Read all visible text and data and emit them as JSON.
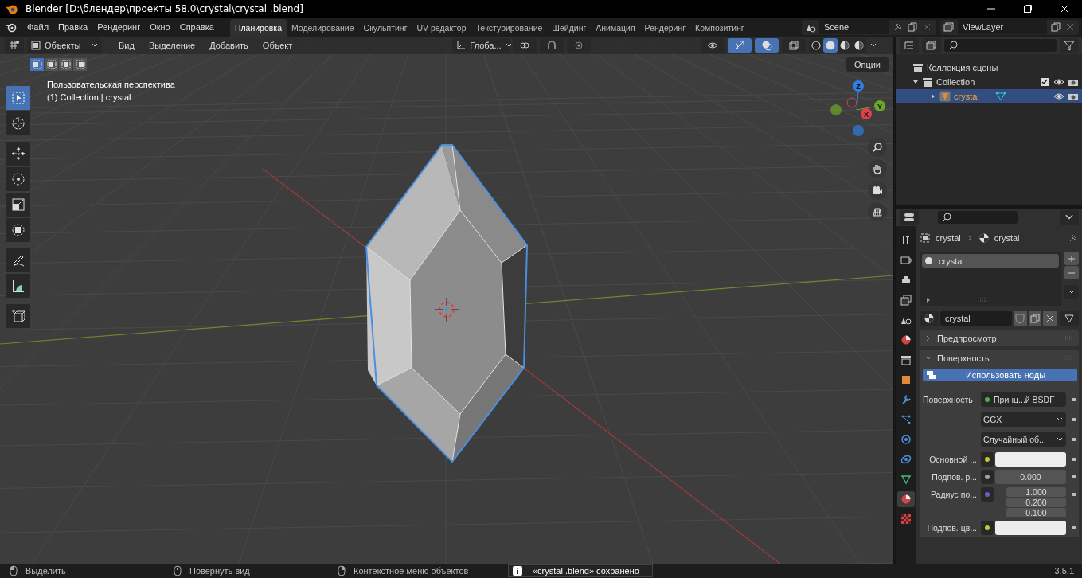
{
  "window": {
    "title": "Blender [D:\\блендер\\проекты 58.0\\crystal\\crystal .blend]"
  },
  "menu": [
    "Файл",
    "Правка",
    "Рендеринг",
    "Окно",
    "Справка"
  ],
  "workspaces": [
    {
      "label": "Планировка",
      "selected": true
    },
    {
      "label": "Моделирование",
      "selected": false
    },
    {
      "label": "Скульптинг",
      "selected": false
    },
    {
      "label": "UV-редактор",
      "selected": false
    },
    {
      "label": "Текстурирование",
      "selected": false
    },
    {
      "label": "Шейдинг",
      "selected": false
    },
    {
      "label": "Анимация",
      "selected": false
    },
    {
      "label": "Рендеринг",
      "selected": false
    },
    {
      "label": "Композитинг",
      "selected": false
    }
  ],
  "scene": "Scene",
  "view_layer": "ViewLayer",
  "viewport": {
    "mode": "Объекты",
    "menus": [
      "Вид",
      "Выделение",
      "Добавить",
      "Объект"
    ],
    "orientation": "Глоба...",
    "options": "Опции",
    "select_modes": [
      {
        "selected": true
      },
      {
        "selected": false
      },
      {
        "selected": false
      },
      {
        "selected": false
      }
    ],
    "toggles": [
      {
        "kind": "gizmo",
        "on": true
      },
      {
        "kind": "overlay",
        "on": true
      },
      {
        "kind": "xray",
        "on": false
      }
    ],
    "shading": [
      {
        "selected": false
      },
      {
        "selected": true
      },
      {
        "selected": false
      },
      {
        "selected": false
      }
    ],
    "view_name": "Пользовательская перспектива",
    "object_info": "(1) Collection | crystal",
    "tools": [
      {
        "kind": "select",
        "selected": true
      },
      {
        "kind": "cursor",
        "selected": false
      },
      {
        "kind": "move",
        "selected": false
      },
      {
        "kind": "rotate",
        "selected": false
      },
      {
        "kind": "scale",
        "selected": false
      },
      {
        "kind": "transform",
        "selected": false
      },
      {
        "kind": "annotate",
        "selected": false
      },
      {
        "kind": "measure",
        "selected": false
      },
      {
        "kind": "add",
        "selected": false
      }
    ],
    "axes": [
      {
        "label": "Z",
        "color": "#2f7ee0"
      },
      {
        "label": "Y",
        "color": "#6fa52b"
      },
      {
        "label": "X",
        "color": "#e0404a"
      }
    ]
  },
  "outliner": {
    "label": "Коллекция сцены",
    "children": [
      {
        "label": "Collection",
        "expanded": true,
        "checked": true,
        "selected": false,
        "children": [
          {
            "label": "crystal",
            "expanded": false,
            "selected": true
          }
        ]
      }
    ]
  },
  "properties": {
    "tabs": [
      {
        "kind": "tool",
        "selected": false
      },
      {
        "kind": "render",
        "selected": false
      },
      {
        "kind": "output",
        "selected": false
      },
      {
        "kind": "viewlayer",
        "selected": false
      },
      {
        "kind": "scene",
        "selected": false
      },
      {
        "kind": "world",
        "selected": false
      },
      {
        "kind": "collection",
        "selected": false
      },
      {
        "kind": "object",
        "selected": false
      },
      {
        "kind": "modifiers",
        "selected": false
      },
      {
        "kind": "particles",
        "selected": false
      },
      {
        "kind": "physics",
        "selected": false
      },
      {
        "kind": "constraints",
        "selected": false
      },
      {
        "kind": "data",
        "selected": false
      },
      {
        "kind": "material",
        "selected": true
      },
      {
        "kind": "texture",
        "selected": false
      }
    ],
    "breadcrumb": [
      "crystal",
      "crystal"
    ],
    "slots": [
      {
        "label": "crystal",
        "selected": true
      }
    ],
    "material": "crystal",
    "panels": [
      {
        "label": "Предпросмотр",
        "expanded": false
      },
      {
        "label": "Поверхность",
        "expanded": true
      }
    ],
    "use_nodes": "Использовать ноды",
    "fields": [
      {
        "kind": "link",
        "label": "Поверхность",
        "value": "Принц...й BSDF",
        "color": "#4cb04c"
      },
      {
        "kind": "dropdown",
        "value": "GGX"
      },
      {
        "kind": "dropdown",
        "value": "Случайный об..."
      },
      {
        "kind": "swatch",
        "label": "Основной ...",
        "color": "#c7c729"
      },
      {
        "kind": "number",
        "label": "Подпов. р...",
        "value": "0.000",
        "color": "#a1a1a1"
      },
      {
        "kind": "vector",
        "label": "Радиус по...",
        "values": [
          "1.000",
          "0.200",
          "0.100"
        ],
        "color": "#6363c7"
      },
      {
        "kind": "swatch",
        "label": "Подпов. цв...",
        "color": "#c7c729"
      }
    ]
  },
  "status": {
    "hints": [
      {
        "kind": "left",
        "label": "Выделить"
      },
      {
        "kind": "middle",
        "label": "Повернуть вид"
      },
      {
        "kind": "right",
        "label": "Контекстное меню объектов"
      }
    ],
    "report": "«crystal .blend» сохранено",
    "version": "3.5.1"
  }
}
